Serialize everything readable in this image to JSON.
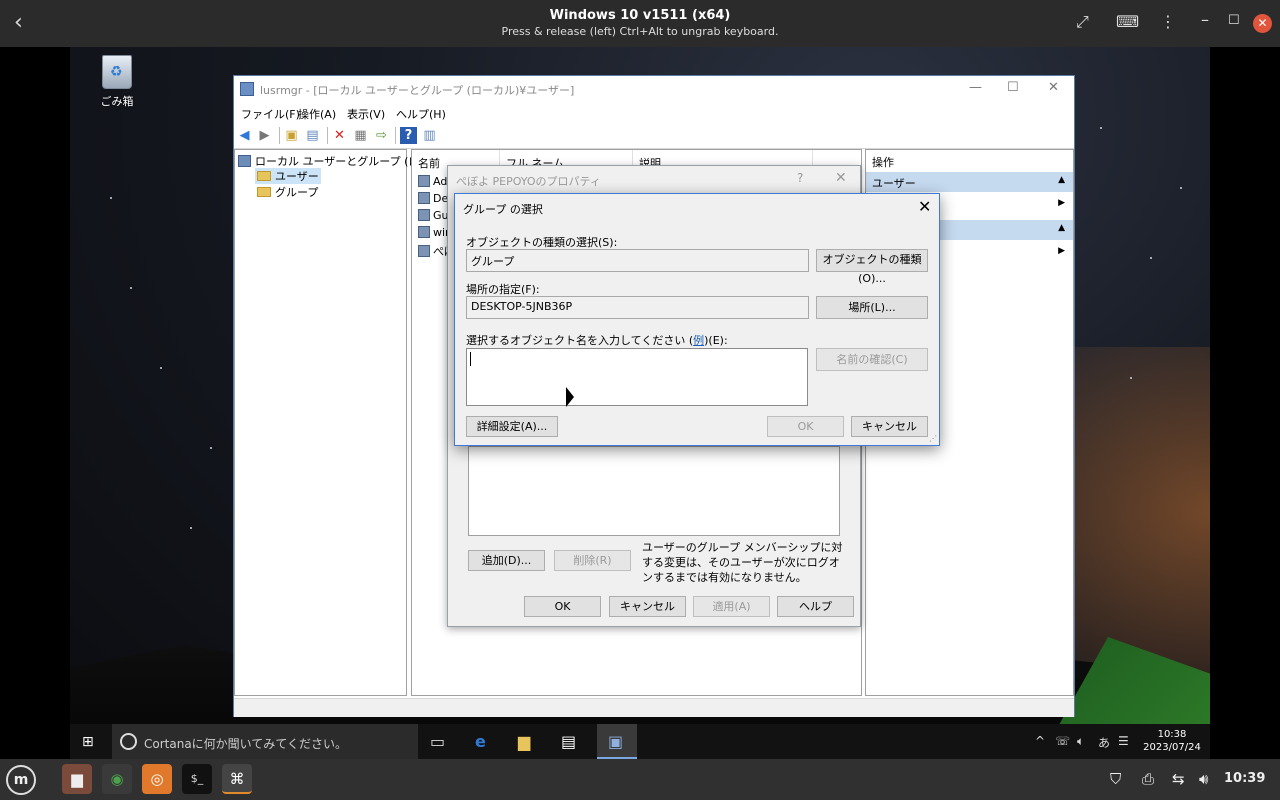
{
  "host": {
    "title": "Windows 10 v1511 (x64)",
    "subtitle": "Press & release (left) Ctrl+Alt to ungrab keyboard.",
    "time": "10:39"
  },
  "desktop": {
    "recycle_bin_label": "ごみ箱"
  },
  "mmc": {
    "title": "lusrmgr - [ローカル ユーザーとグループ (ローカル)¥ユーザー]",
    "menu": [
      "ファイル(F)",
      "操作(A)",
      "表示(V)",
      "ヘルプ(H)"
    ],
    "tree": {
      "root": "ローカル ユーザーとグループ (ローカル)",
      "children": [
        "ユーザー",
        "グループ"
      ]
    },
    "list": {
      "columns": [
        "名前",
        "フル ネーム",
        "説明"
      ],
      "rows": [
        "Adm",
        "Def",
        "Gue",
        "win",
        "ぺぼ"
      ]
    },
    "actions": {
      "header": "操作",
      "sections": [
        "ユーザー",
        ""
      ]
    }
  },
  "props": {
    "title": "ぺぼよ PEPOYOのプロパティ",
    "help": "?",
    "add_button": "追加(D)...",
    "remove_button": "削除(R)",
    "note": "ユーザーのグループ メンバーシップに対する変更は、そのユーザーが次にログオンするまでは有効になりません。",
    "ok": "OK",
    "cancel": "キャンセル",
    "apply": "適用(A)",
    "help_button": "ヘルプ"
  },
  "group_select": {
    "title": "グループ の選択",
    "object_type_label": "オブジェクトの種類の選択(S):",
    "object_type_value": "グループ",
    "object_type_button": "オブジェクトの種類(O)...",
    "location_label": "場所の指定(F):",
    "location_value": "DESKTOP-5JNB36P",
    "location_button": "場所(L)...",
    "name_label_prefix": "選択するオブジェクト名を入力してください (",
    "name_label_link": "例",
    "name_label_suffix": ")(E):",
    "check_names_button": "名前の確認(C)",
    "advanced_button": "詳細設定(A)...",
    "ok": "OK",
    "cancel": "キャンセル"
  },
  "taskbar": {
    "cortana_placeholder": "Cortanaに何か聞いてみてください。",
    "clock_time": "10:38",
    "clock_date": "2023/07/24"
  }
}
